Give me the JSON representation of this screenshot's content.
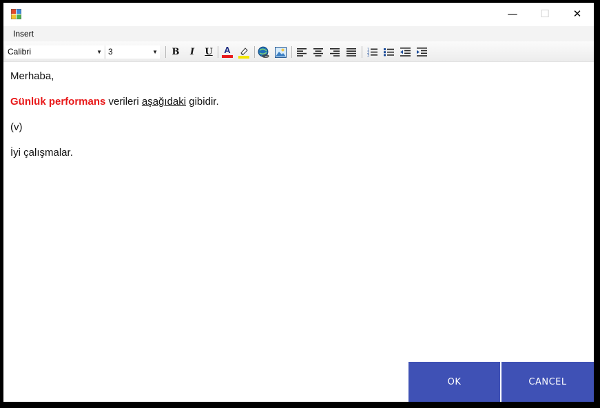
{
  "titlebar": {
    "icons": {
      "app": "app-window-icon",
      "minimize": "minimize-icon",
      "maximize": "maximize-icon",
      "close": "close-icon"
    },
    "minimize_glyph": "—",
    "maximize_glyph": "☐",
    "close_glyph": "✕"
  },
  "menu": {
    "items": [
      {
        "label": "Insert"
      }
    ]
  },
  "toolbar": {
    "font_name": "Calibri",
    "font_size": "3",
    "bold_label": "B",
    "italic_label": "I",
    "underline_label": "U",
    "font_color_label": "A",
    "font_color": "#e8191a",
    "highlight_color": "#f3e600",
    "icons": [
      "bold-icon",
      "italic-icon",
      "underline-icon",
      "font-color-icon",
      "highlight-icon",
      "insert-link-icon",
      "insert-image-icon",
      "align-left-icon",
      "align-center-icon",
      "align-right-icon",
      "justify-icon",
      "numbered-list-icon",
      "bulleted-list-icon",
      "decrease-indent-icon",
      "increase-indent-icon"
    ]
  },
  "editor": {
    "line1": "Merhaba,",
    "line2_red": "Günlük performans",
    "line2_mid": " verileri ",
    "line2_underlined": "aşağıdaki",
    "line2_end": " gibidir.",
    "line3": "(v)",
    "line4": "İyi çalışmalar.",
    "highlight_color": "#e8191a"
  },
  "actions": {
    "ok_label": "OK",
    "cancel_label": "CANCEL",
    "button_color": "#3f51b5"
  }
}
